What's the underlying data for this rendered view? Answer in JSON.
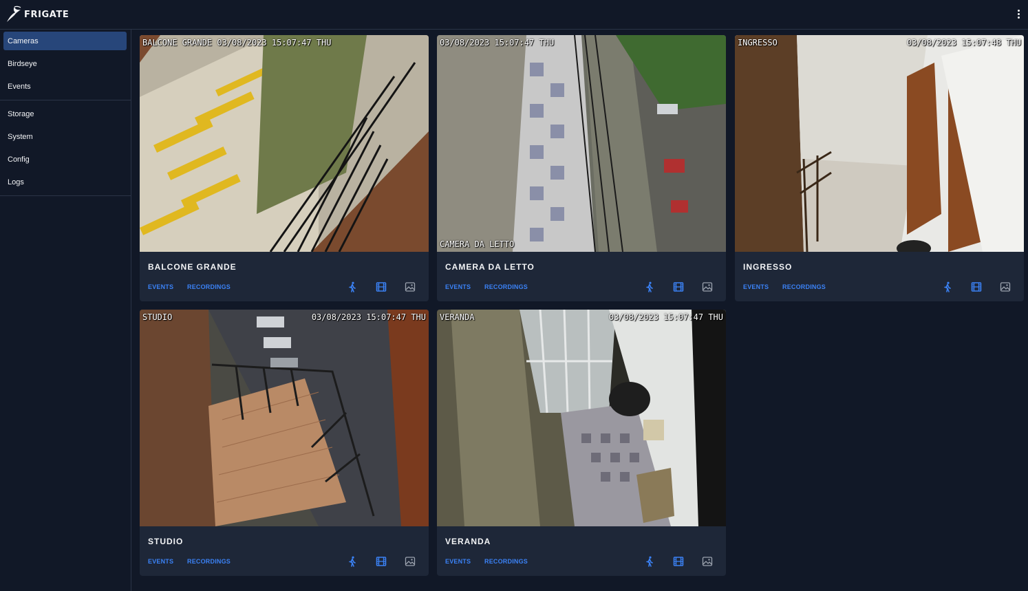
{
  "app": {
    "title": "FRIGATE",
    "logo_icon": "frigate-bird-icon",
    "menu_icon": "more-vertical-icon"
  },
  "sidebar": {
    "groups": [
      [
        {
          "label": "Cameras",
          "active": true
        },
        {
          "label": "Birdseye",
          "active": false
        },
        {
          "label": "Events",
          "active": false
        }
      ],
      [
        {
          "label": "Storage",
          "active": false
        },
        {
          "label": "System",
          "active": false
        },
        {
          "label": "Config",
          "active": false
        },
        {
          "label": "Logs",
          "active": false
        }
      ]
    ]
  },
  "colors": {
    "background": "#111827",
    "card": "#1e2738",
    "accent": "#3b82f6",
    "active_nav": "#27467a",
    "icon_gray": "#9ca3af"
  },
  "cameras": [
    {
      "name": "BALCONE GRANDE",
      "overlay_left": "BALCONE GRANDE  03/08/2023 15:07:47 THU",
      "overlay_right": "",
      "overlay_bottom": "",
      "events_label": "EVENTS",
      "recordings_label": "RECORDINGS",
      "detect_icon": "person-walking-icon",
      "record_icon": "film-icon",
      "snapshot_icon": "image-icon",
      "detect_enabled": true,
      "record_enabled": true,
      "snapshot_enabled": false
    },
    {
      "name": "CAMERA DA LETTO",
      "overlay_left": "03/08/2023 15:07:47 THU",
      "overlay_right": "",
      "overlay_bottom": "CAMERA DA LETTO",
      "events_label": "EVENTS",
      "recordings_label": "RECORDINGS",
      "detect_icon": "person-walking-icon",
      "record_icon": "film-icon",
      "snapshot_icon": "image-icon",
      "detect_enabled": true,
      "record_enabled": true,
      "snapshot_enabled": false
    },
    {
      "name": "INGRESSO",
      "overlay_left": "INGRESSO",
      "overlay_right": "03/08/2023 15:07:48 THU",
      "overlay_bottom": "",
      "events_label": "EVENTS",
      "recordings_label": "RECORDINGS",
      "detect_icon": "person-walking-icon",
      "record_icon": "film-icon",
      "snapshot_icon": "image-icon",
      "detect_enabled": true,
      "record_enabled": true,
      "snapshot_enabled": false
    },
    {
      "name": "STUDIO",
      "overlay_left": "STUDIO",
      "overlay_right": "03/08/2023 15:07:47 THU",
      "overlay_bottom": "",
      "events_label": "EVENTS",
      "recordings_label": "RECORDINGS",
      "detect_icon": "person-walking-icon",
      "record_icon": "film-icon",
      "snapshot_icon": "image-icon",
      "detect_enabled": true,
      "record_enabled": true,
      "snapshot_enabled": false
    },
    {
      "name": "VERANDA",
      "overlay_left": "VERANDA",
      "overlay_right": "03/08/2023 15:07:47 THU",
      "overlay_bottom": "",
      "events_label": "EVENTS",
      "recordings_label": "RECORDINGS",
      "detect_icon": "person-walking-icon",
      "record_icon": "film-icon",
      "snapshot_icon": "image-icon",
      "detect_enabled": true,
      "record_enabled": true,
      "snapshot_enabled": false
    }
  ]
}
